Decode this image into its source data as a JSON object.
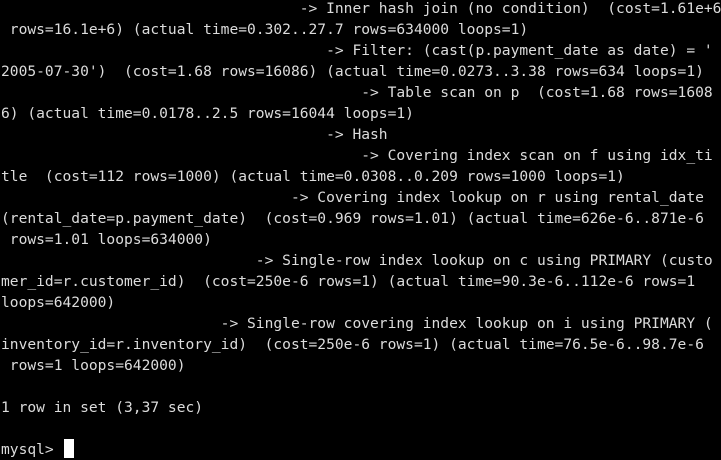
{
  "terminal": {
    "lines": [
      "                                  -> Inner hash join (no condition)  (cost=1.61e+6",
      " rows=16.1e+6) (actual time=0.302..27.7 rows=634000 loops=1)",
      "                                     -> Filter: (cast(p.payment_date as date) = '",
      "2005-07-30')  (cost=1.68 rows=16086) (actual time=0.0273..3.38 rows=634 loops=1)",
      "                                         -> Table scan on p  (cost=1.68 rows=1608",
      "6) (actual time=0.0178..2.5 rows=16044 loops=1)",
      "                                     -> Hash",
      "                                         -> Covering index scan on f using idx_ti",
      "tle  (cost=112 rows=1000) (actual time=0.0308..0.209 rows=1000 loops=1)",
      "                                 -> Covering index lookup on r using rental_date",
      "(rental_date=p.payment_date)  (cost=0.969 rows=1.01) (actual time=626e-6..871e-6",
      " rows=1.01 loops=634000)",
      "                             -> Single-row index lookup on c using PRIMARY (custo",
      "mer_id=r.customer_id)  (cost=250e-6 rows=1) (actual time=90.3e-6..112e-6 rows=1",
      "loops=642000)",
      "                         -> Single-row covering index lookup on i using PRIMARY (",
      "inventory_id=r.inventory_id)  (cost=250e-6 rows=1) (actual time=76.5e-6..98.7e-6",
      " rows=1 loops=642000)",
      "",
      "1 row in set (3,37 sec)",
      "",
      "mysql> "
    ]
  },
  "colors": {
    "background": "#000000",
    "foreground": "#dcdcdc",
    "cursor": "#ffffff"
  }
}
